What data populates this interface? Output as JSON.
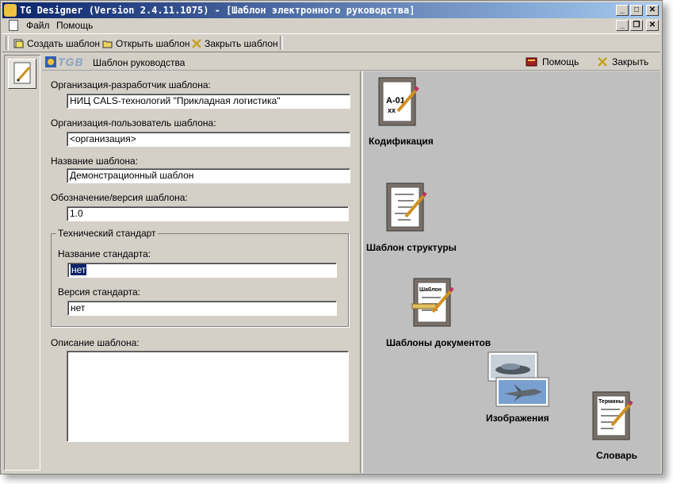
{
  "window": {
    "title": "TG Designer (Version 2.4.11.1075) - [Шаблон электронного руководства]",
    "controls": [
      "_",
      "□",
      "✕"
    ],
    "child_controls": [
      "_",
      "❐",
      "✕"
    ]
  },
  "menu": {
    "items": [
      "Файл",
      "Помощь"
    ]
  },
  "toolbar": {
    "create": "Создать шаблон",
    "open": "Открыть шаблон",
    "close": "Закрыть шаблон"
  },
  "header": {
    "logo": "TGB",
    "title": "Шаблон руководства",
    "help": "Помощь",
    "close": "Закрыть"
  },
  "form": {
    "developer_label": "Организация-разработчик шаблона:",
    "developer_value": "НИЦ CALS-технологий \"Прикладная логистика\"",
    "user_label": "Организация-пользователь шаблона:",
    "user_value": "<организация>",
    "name_label": "Название шаблона:",
    "name_value": "Демонстрационный шаблон",
    "version_label": "Обозначение/версия шаблона:",
    "version_value": "1.0",
    "standard_group": "Технический стандарт",
    "standard_name_label": "Название стандарта:",
    "standard_name_value": "нет",
    "standard_version_label": "Версия стандарта:",
    "standard_version_value": "нет",
    "description_label": "Описание шаблона:",
    "description_value": ""
  },
  "icons": {
    "codification": {
      "label": "Кодификация",
      "glyph_line1": "А-01",
      "glyph_line2": "хх"
    },
    "structure": {
      "label": "Шаблон структуры"
    },
    "documents": {
      "label": "Шаблоны документов",
      "glyph": "Шаблон"
    },
    "images": {
      "label": "Изображения"
    },
    "dictionary": {
      "label": "Словарь",
      "glyph": "Термины"
    }
  }
}
